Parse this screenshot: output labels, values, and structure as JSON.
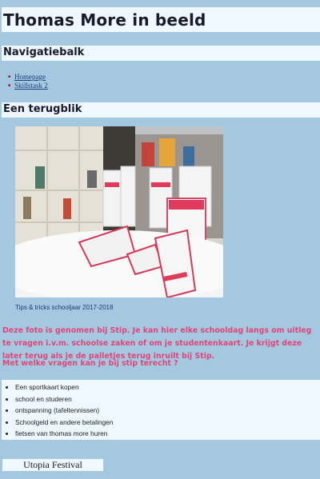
{
  "page": {
    "title": "Thomas More in beeld"
  },
  "nav": {
    "heading": "Navigatiebalk",
    "links": [
      "Homepage",
      "Skillstask 2"
    ]
  },
  "section": {
    "heading": "Een terugblik",
    "photo_caption": "Tips & tricks schooljaar 2017-2018",
    "intro": "Deze foto is genomen bij Stip. Je kan hier elke schooldag langs om uitleg te vragen i.v.m. schoolse zaken of om je studentenkaart. Je krijgt deze later terug als je de palletjes terug inruilt bij Stip.",
    "question": "Met welke vragen kan je bij stip terecht ?",
    "topics": [
      "Een sportkaart kopen",
      "school en studeren",
      "ontspanning (tafeltennissen)",
      "Schoolgeld en andere betalingen",
      "fietsen van thomas more huren"
    ]
  },
  "footer": {
    "festival": "Utopia Festival"
  },
  "colors": {
    "background": "#a3c8e0",
    "band": "#f0f8ff",
    "accent_text": "#e0457a",
    "link": "#1a3f7a"
  }
}
